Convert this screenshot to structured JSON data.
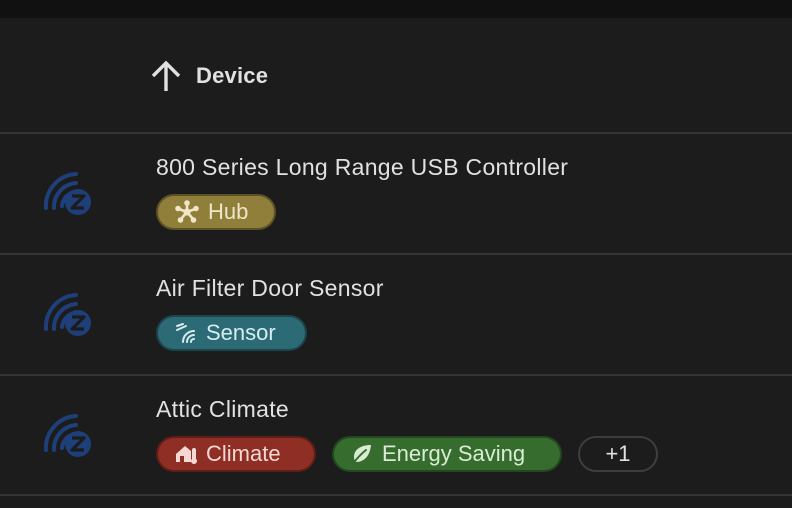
{
  "table": {
    "header": {
      "label": "Device",
      "sort_direction": "ascending",
      "sort_icon": "arrow-up-icon"
    },
    "rows": [
      {
        "name": "800 Series Long Range USB Controller",
        "icon": "zwave-icon",
        "tags": [
          {
            "label": "Hub",
            "icon": "hub-icon",
            "color": "#8f7f3a"
          }
        ]
      },
      {
        "name": "Air Filter Door Sensor",
        "icon": "zwave-icon",
        "tags": [
          {
            "label": "Sensor",
            "icon": "sensor-icon",
            "color": "#2c6b76"
          }
        ]
      },
      {
        "name": "Attic Climate",
        "icon": "zwave-icon",
        "tags": [
          {
            "label": "Climate",
            "icon": "home-thermometer-icon",
            "color": "#8f2e25"
          },
          {
            "label": "Energy Saving",
            "icon": "leaf-icon",
            "color": "#366d2e"
          }
        ],
        "more": "+1"
      }
    ]
  },
  "colors": {
    "background": "#1c1c1c",
    "divider": "#343434",
    "zwave_icon": "#1e3f7a",
    "text": "#e1e1e1"
  }
}
